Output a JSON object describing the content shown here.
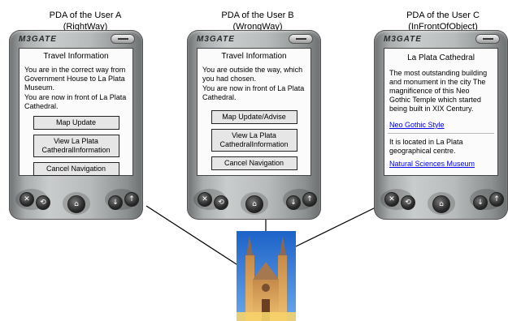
{
  "captions": {
    "a_line1": "PDA of the User A",
    "a_line2": "(RightWay)",
    "b_line1": "PDA of the User B",
    "b_line2": "(WrongWay)",
    "c_line1": "PDA of the User C",
    "c_line2": "(InFrontOfObject)"
  },
  "device": {
    "brand": "M3GATE"
  },
  "pda_a": {
    "title": "Travel Information",
    "message": "You are in the correct way from Government House to La Plata Museum.",
    "message2": "You are now in front of La Plata Cathedral.",
    "buttons": [
      "Map Update",
      "View La Plata CathedralInformation",
      "Cancel Navigation"
    ]
  },
  "pda_b": {
    "title": "Travel Information",
    "message": "You are outside the way, which you had chosen.",
    "message2": "You are now in front of La Plata Cathedral.",
    "buttons": [
      "Map Update/Advise",
      "View La Plata CathedralInformation",
      "Cancel Navigation"
    ]
  },
  "pda_c": {
    "title": "La Plata Cathedral",
    "description": "The most outstanding building and monument in the city The magnificence of this Neo Gothic Temple which started being built in XIX Century.",
    "link1": "Neo Gothic Style",
    "location": "It is located in La Plata geographical centre.",
    "link2": "Natural Sciences Museum"
  },
  "hardware_buttons": {
    "left": "close-icon",
    "left2": "rotate-icon",
    "center": "home-icon",
    "right2": "down-arrow-icon",
    "right": "up-arrow-icon"
  }
}
